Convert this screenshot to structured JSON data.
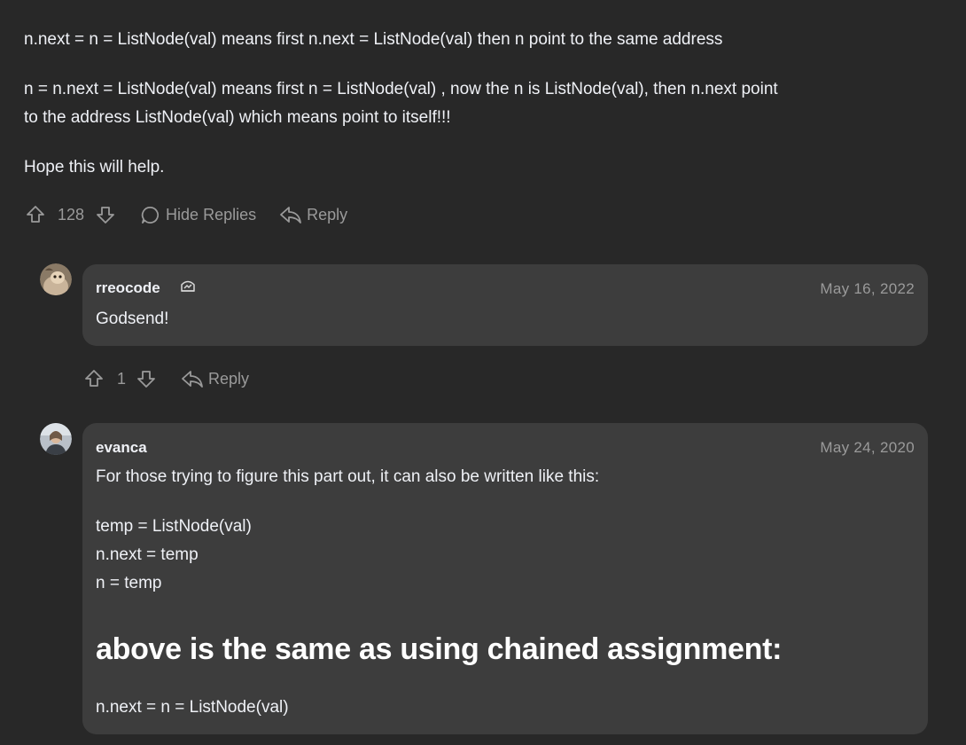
{
  "top_comment": {
    "paragraphs": [
      "n.next = n = ListNode(val) means first n.next = ListNode(val) then n point to the same address",
      "n = n.next = ListNode(val) means first n = ListNode(val) , now the n is ListNode(val), then n.next point",
      "to the address ListNode(val) which means point to itself!!!",
      "Hope this will help."
    ],
    "vote_count": "128",
    "hide_replies_label": "Hide Replies",
    "reply_label": "Reply"
  },
  "replies": [
    {
      "username": "rreocode",
      "badge_icon": "badge-icon",
      "date": "May 16, 2022",
      "body": "Godsend!",
      "vote_count": "1",
      "reply_label": "Reply"
    },
    {
      "username": "evanca",
      "date": "May 24, 2020",
      "body_lines": [
        "For those trying to figure this part out, it can also be written like this:",
        "temp = ListNode(val)",
        "n.next = temp",
        "n = temp"
      ],
      "heading": "above is the same as using chained assignment:",
      "closing_line": "n.next = n = ListNode(val)"
    }
  ],
  "colors": {
    "background": "#282828",
    "bubble": "#3d3d3d",
    "text": "#eff1f6",
    "muted": "#9a9a9a"
  }
}
